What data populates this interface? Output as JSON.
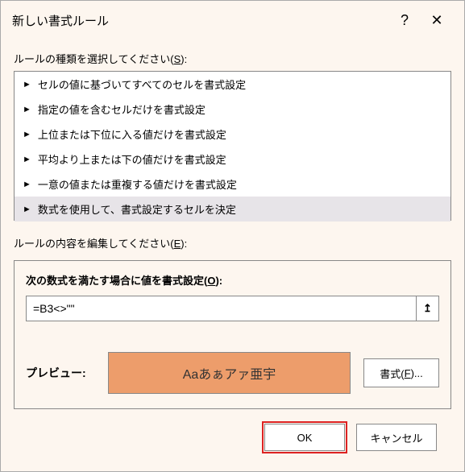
{
  "titlebar": {
    "title": "新しい書式ルール",
    "help": "?",
    "close": "✕"
  },
  "ruleTypeLabel": {
    "pre": "ルールの種類を選択してください(",
    "key": "S",
    "post": "):"
  },
  "ruleTypes": [
    "セルの値に基づいてすべてのセルを書式設定",
    "指定の値を含むセルだけを書式設定",
    "上位または下位に入る値だけを書式設定",
    "平均より上または下の値だけを書式設定",
    "一意の値または重複する値だけを書式設定",
    "数式を使用して、書式設定するセルを決定"
  ],
  "ruleTypeSelectedIndex": 5,
  "editLabel": {
    "pre": "ルールの内容を編集してください(",
    "key": "E",
    "post": "):"
  },
  "formulaLabel": {
    "pre": "次の数式を満たす場合に値を書式設定(",
    "key": "O",
    "post": "):"
  },
  "formulaValue": "=B3<>\"\"",
  "refIcon": "↥",
  "previewLabel": "プレビュー:",
  "previewText": "Aaあぁアァ亜宇",
  "formatBtn": {
    "pre": "書式(",
    "key": "F",
    "post": ")..."
  },
  "buttons": {
    "ok": "OK",
    "cancel": "キャンセル"
  }
}
